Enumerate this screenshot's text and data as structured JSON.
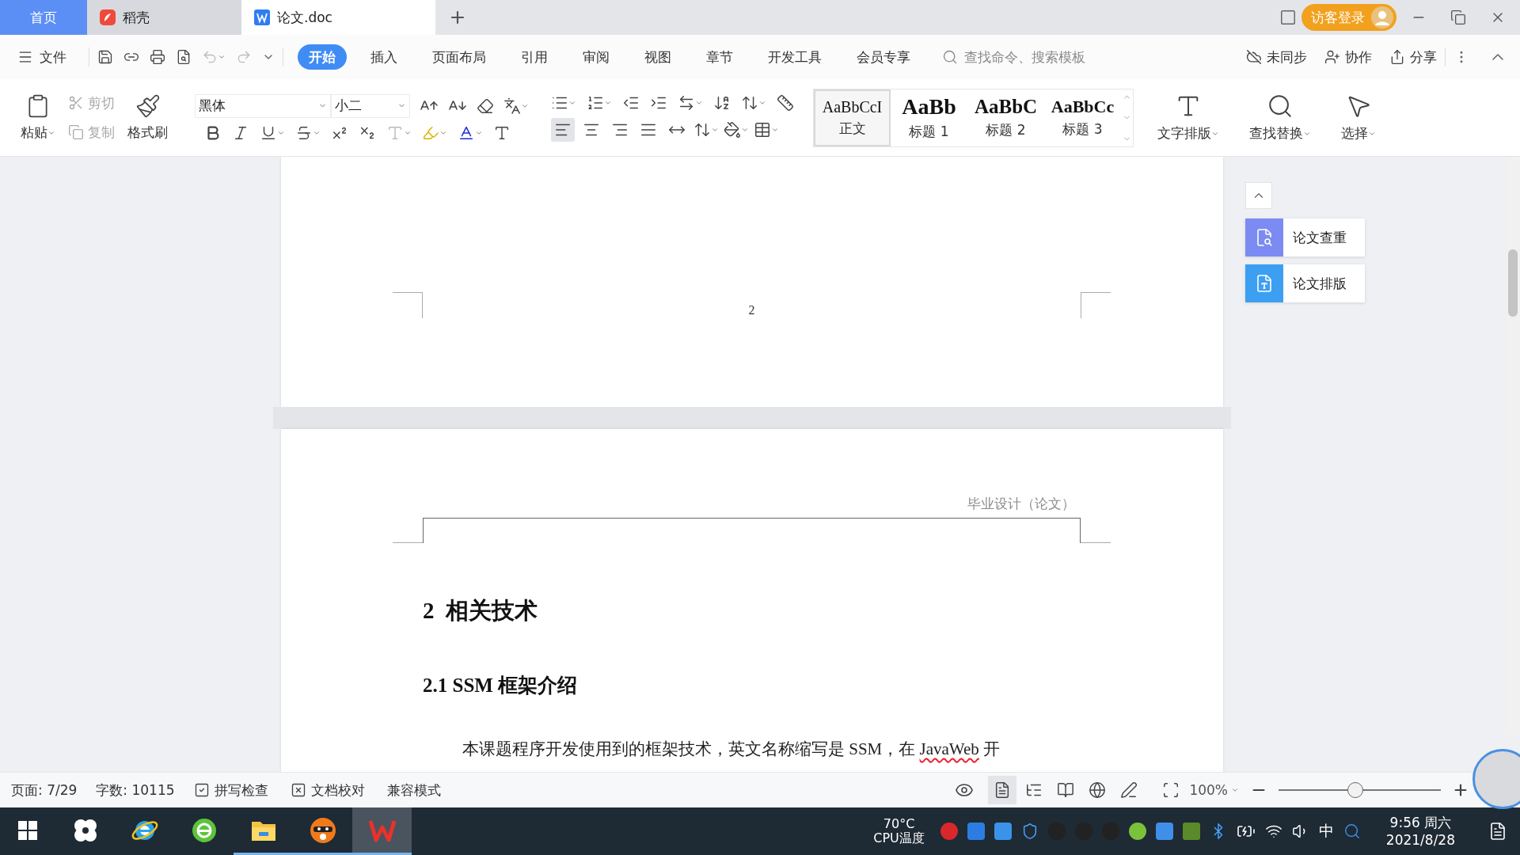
{
  "title_tabs": [
    {
      "label": "首页",
      "kind": "home",
      "selected": false
    },
    {
      "label": "稻壳",
      "kind": "docer",
      "selected": false
    },
    {
      "label": "论文.doc",
      "kind": "document",
      "selected": true
    }
  ],
  "login_button": "访客登录",
  "menu": {
    "file": "文件",
    "tabs": [
      {
        "label": "开始",
        "selected": true
      },
      {
        "label": "插入",
        "selected": false
      },
      {
        "label": "页面布局",
        "selected": false
      },
      {
        "label": "引用",
        "selected": false
      },
      {
        "label": "审阅",
        "selected": false
      },
      {
        "label": "视图",
        "selected": false
      },
      {
        "label": "章节",
        "selected": false
      },
      {
        "label": "开发工具",
        "selected": false
      },
      {
        "label": "会员专享",
        "selected": false
      }
    ],
    "search": {
      "placeholder": "查找命令、搜索模板"
    },
    "actions": [
      "未同步",
      "协作",
      "分享"
    ]
  },
  "ribbon": {
    "clipboard": [
      {
        "label": "粘贴",
        "kind": "paste",
        "disabled": false
      },
      {
        "label": "剪切",
        "kind": "cut",
        "disabled": true
      },
      {
        "label": "复制",
        "kind": "copy",
        "disabled": true
      },
      {
        "label": "格式刷",
        "kind": "painter",
        "disabled": false
      }
    ],
    "font": {
      "name": "黑体",
      "size": "小二"
    },
    "align_buttons": [
      {
        "selected": true
      },
      {
        "selected": false
      },
      {
        "selected": false
      },
      {
        "selected": false
      },
      {
        "selected": false
      }
    ],
    "styles": [
      {
        "preview": "AaBbCcI",
        "label": "正文",
        "kind": "normal",
        "selected": true
      },
      {
        "preview": "AaBb",
        "label": "标题 1",
        "kind": "heading1",
        "selected": false
      },
      {
        "preview": "AaBbC",
        "label": "标题 2",
        "kind": "heading2",
        "selected": false
      },
      {
        "preview": "AaBbCc",
        "label": "标题 3",
        "kind": "heading3",
        "selected": false
      }
    ],
    "tools": [
      {
        "label": "文字排版",
        "kind": "layout"
      },
      {
        "label": "查找替换",
        "kind": "find"
      },
      {
        "label": "选择",
        "kind": "select"
      }
    ]
  },
  "document": {
    "page_number": "2",
    "header": "毕业设计（论文）",
    "heading1": "2  相关技术",
    "heading2": "2.1 SSM 框架介绍",
    "paragraph": [
      {
        "text": "本课题程序开发使用到的框架技术，英文名称缩写是 SSM，在 ",
        "misspelled": false
      },
      {
        "text": "JavaWeb",
        "misspelled": true
      },
      {
        "text": " 开",
        "misspelled": false
      }
    ]
  },
  "side_panel": [
    {
      "label": "论文查重",
      "color": "#7b8bf2"
    },
    {
      "label": "论文排版",
      "color": "#3c9ff2"
    }
  ],
  "status_bar": {
    "page": "页面: 7/29",
    "words": "字数: 10115",
    "tools": [
      "拼写检查",
      "文档校对"
    ],
    "mode": "兼容模式",
    "view_modes": [
      {
        "selected": true
      },
      {
        "selected": false
      },
      {
        "selected": false
      },
      {
        "selected": false
      },
      {
        "selected": false
      }
    ],
    "zoom": "100%",
    "zoom_slider": {
      "level": 0.47
    }
  },
  "taskbar": {
    "apps": [
      {
        "kind": "fan",
        "running": false,
        "selected": false
      },
      {
        "kind": "ie",
        "running": false,
        "selected": false
      },
      {
        "kind": "globe",
        "running": false,
        "selected": false
      },
      {
        "kind": "folder",
        "running": true,
        "selected": false
      },
      {
        "kind": "mascot",
        "running": true,
        "selected": false
      },
      {
        "kind": "office",
        "running": true,
        "selected": true
      }
    ],
    "cpu_temp": "70°C",
    "cpu_label": "CPU温度",
    "ime": "中",
    "time": "9:56 周六",
    "date": "2021/8/28"
  }
}
